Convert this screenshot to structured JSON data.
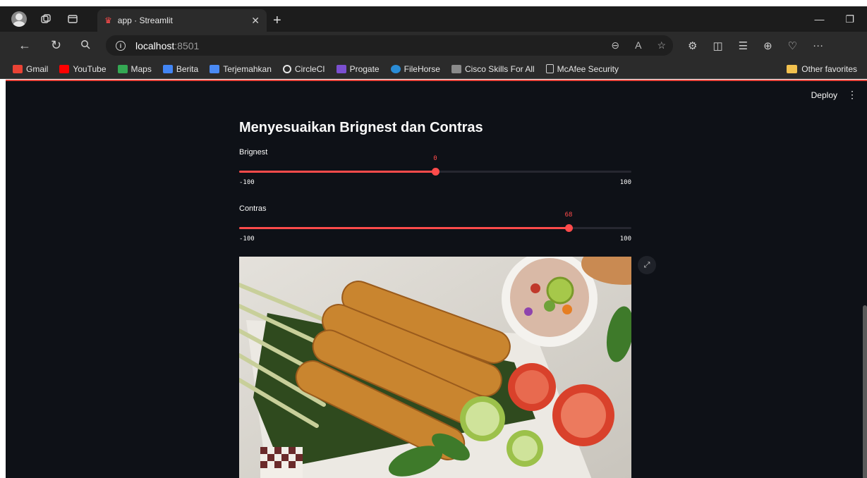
{
  "browser": {
    "tab_title": "app · Streamlit",
    "url_host": "localhost",
    "url_port": ":8501",
    "bookmarks": [
      {
        "label": "Gmail",
        "color": "#ea4335"
      },
      {
        "label": "YouTube",
        "color": "#ff0000"
      },
      {
        "label": "Maps",
        "color": "#34a853"
      },
      {
        "label": "Berita",
        "color": "#4285f4"
      },
      {
        "label": "Terjemahkan",
        "color": "#4a8af4"
      },
      {
        "label": "CircleCI",
        "color": "#e6e6e6"
      },
      {
        "label": "Progate",
        "color": "#7b4fd0"
      },
      {
        "label": "FileHorse",
        "color": "#2a8cd6"
      },
      {
        "label": "Cisco Skills For All",
        "color": "#8a8a8a"
      },
      {
        "label": "McAfee Security",
        "color": "#cfcfcf"
      }
    ],
    "other_favorites": "Other favorites"
  },
  "app": {
    "deploy_label": "Deploy",
    "title": "Menyesuaikan Brignest dan Contras",
    "sliders": [
      {
        "label": "Brignest",
        "value": 0,
        "value_text": "0",
        "min": -100,
        "max": 100,
        "min_text": "-100",
        "max_text": "100"
      },
      {
        "label": "Contras",
        "value": 68,
        "value_text": "68",
        "min": -100,
        "max": 100,
        "min_text": "-100",
        "max_text": "100"
      }
    ]
  },
  "colors": {
    "accent": "#ff4b4b",
    "app_bg": "#0e1117"
  }
}
